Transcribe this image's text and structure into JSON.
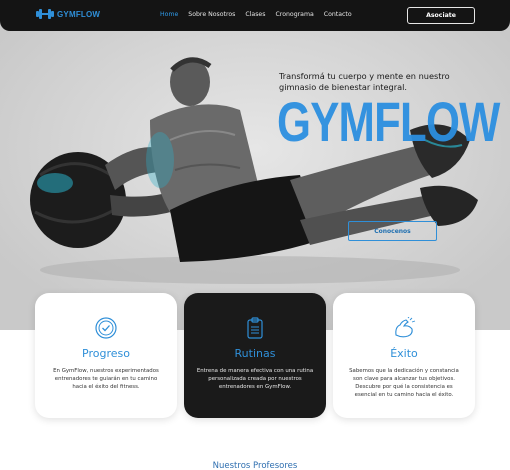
{
  "brand": {
    "name": "GYMFLOW",
    "accent": "#2f8fd8"
  },
  "nav": {
    "links": [
      "Home",
      "Sobre Nosotros",
      "Clases",
      "Cronograma",
      "Contacto"
    ],
    "active": "Home",
    "cta": "Asociate"
  },
  "hero": {
    "tagline": "Transformá tu cuerpo y mente en nuestro gimnasio de bienestar integral.",
    "title": "GYMFLOW",
    "button": "Conocenos"
  },
  "cards": [
    {
      "icon": "check-circle-icon",
      "title": "Progreso",
      "desc": "En GymFlow, nuestros experimentados entrenadores te guiarán en tu camino hacia el éxito del fitness."
    },
    {
      "icon": "clipboard-icon",
      "title": "Rutinas",
      "desc": "Entrena de manera efectiva con una rutina personalizada creada por nuestros entrenadores en GymFlow."
    },
    {
      "icon": "flexed-arm-icon",
      "title": "Éxito",
      "desc": "Sabemos que la dedicación y constancia son clave para alcanzar tus objetivos. Descubre por qué la consistencia es esencial en tu camino hacia el éxito."
    }
  ],
  "section": {
    "title": "Nuestros Profesores"
  }
}
